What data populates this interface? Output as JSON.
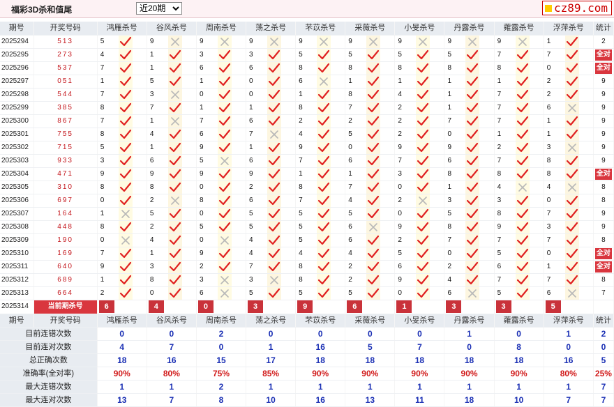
{
  "header": {
    "title": "福彩3D杀和值尾",
    "period_select": "近20期",
    "logo_text": "cz89.com"
  },
  "columns": {
    "issue": "期号",
    "numbers": "开奖号码",
    "groups": [
      "鸿雁杀号",
      "谷风杀号",
      "周南杀号",
      "荡之杀号",
      "芣苡杀号",
      "采薇杀号",
      "小旻杀号",
      "丹露杀号",
      "蕹露杀号",
      "浮萍杀号"
    ],
    "stat": "统计"
  },
  "rows": [
    {
      "issue": "2025294",
      "num": "513",
      "kill": [
        "5",
        "9",
        "9",
        "9",
        "9",
        "9",
        "9",
        "9",
        "9",
        "1"
      ],
      "ok": [
        1,
        0,
        0,
        0,
        0,
        0,
        0,
        0,
        0,
        1
      ],
      "stat": "2"
    },
    {
      "issue": "2025295",
      "num": "273",
      "kill": [
        "4",
        "1",
        "3",
        "3",
        "5",
        "5",
        "5",
        "5",
        "7",
        "7"
      ],
      "ok": [
        1,
        1,
        1,
        1,
        1,
        1,
        1,
        1,
        1,
        1
      ],
      "stat": "全对"
    },
    {
      "issue": "2025296",
      "num": "537",
      "kill": [
        "7",
        "1",
        "6",
        "6",
        "8",
        "8",
        "8",
        "8",
        "8",
        "0"
      ],
      "ok": [
        1,
        1,
        1,
        1,
        1,
        1,
        1,
        1,
        1,
        1
      ],
      "stat": "全对"
    },
    {
      "issue": "2025297",
      "num": "051",
      "kill": [
        "1",
        "5",
        "1",
        "0",
        "6",
        "1",
        "1",
        "1",
        "1",
        "2"
      ],
      "ok": [
        1,
        1,
        1,
        1,
        0,
        1,
        1,
        1,
        1,
        1
      ],
      "stat": "9"
    },
    {
      "issue": "2025298",
      "num": "544",
      "kill": [
        "7",
        "3",
        "0",
        "0",
        "1",
        "8",
        "4",
        "1",
        "7",
        "2"
      ],
      "ok": [
        1,
        0,
        1,
        1,
        1,
        1,
        1,
        1,
        1,
        1
      ],
      "stat": "9"
    },
    {
      "issue": "2025299",
      "num": "385",
      "kill": [
        "8",
        "7",
        "1",
        "1",
        "8",
        "7",
        "2",
        "1",
        "7",
        "6"
      ],
      "ok": [
        1,
        1,
        1,
        1,
        1,
        1,
        1,
        1,
        1,
        0
      ],
      "stat": "9"
    },
    {
      "issue": "2025300",
      "num": "867",
      "kill": [
        "7",
        "1",
        "7",
        "6",
        "2",
        "2",
        "2",
        "7",
        "7",
        "1"
      ],
      "ok": [
        1,
        0,
        1,
        1,
        1,
        1,
        1,
        1,
        1,
        1
      ],
      "stat": "9"
    },
    {
      "issue": "2025301",
      "num": "755",
      "kill": [
        "8",
        "4",
        "6",
        "7",
        "4",
        "5",
        "2",
        "0",
        "1",
        "1"
      ],
      "ok": [
        1,
        1,
        1,
        0,
        1,
        1,
        1,
        1,
        1,
        1
      ],
      "stat": "9"
    },
    {
      "issue": "2025302",
      "num": "715",
      "kill": [
        "5",
        "1",
        "9",
        "1",
        "9",
        "0",
        "9",
        "9",
        "2",
        "3"
      ],
      "ok": [
        1,
        1,
        1,
        1,
        1,
        1,
        1,
        1,
        1,
        0
      ],
      "stat": "9"
    },
    {
      "issue": "2025303",
      "num": "933",
      "kill": [
        "3",
        "6",
        "5",
        "6",
        "7",
        "6",
        "7",
        "6",
        "7",
        "8"
      ],
      "ok": [
        1,
        1,
        0,
        1,
        1,
        1,
        1,
        1,
        1,
        1
      ],
      "stat": "9"
    },
    {
      "issue": "2025304",
      "num": "471",
      "kill": [
        "9",
        "9",
        "9",
        "9",
        "1",
        "1",
        "3",
        "8",
        "8",
        "8"
      ],
      "ok": [
        1,
        1,
        1,
        1,
        1,
        1,
        1,
        1,
        1,
        1
      ],
      "stat": "全对"
    },
    {
      "issue": "2025305",
      "num": "310",
      "kill": [
        "8",
        "8",
        "0",
        "2",
        "8",
        "7",
        "0",
        "1",
        "4",
        "4"
      ],
      "ok": [
        1,
        1,
        1,
        1,
        1,
        1,
        1,
        1,
        0,
        0
      ],
      "stat": "8"
    },
    {
      "issue": "2025306",
      "num": "697",
      "kill": [
        "0",
        "2",
        "8",
        "6",
        "7",
        "4",
        "2",
        "3",
        "3",
        "0"
      ],
      "ok": [
        1,
        0,
        1,
        1,
        1,
        1,
        0,
        1,
        1,
        1
      ],
      "stat": "8"
    },
    {
      "issue": "2025307",
      "num": "164",
      "kill": [
        "1",
        "5",
        "0",
        "5",
        "5",
        "5",
        "0",
        "5",
        "8",
        "7"
      ],
      "ok": [
        0,
        1,
        1,
        1,
        1,
        1,
        1,
        1,
        1,
        1
      ],
      "stat": "9"
    },
    {
      "issue": "2025308",
      "num": "448",
      "kill": [
        "8",
        "2",
        "5",
        "5",
        "5",
        "6",
        "9",
        "8",
        "9",
        "3"
      ],
      "ok": [
        1,
        1,
        1,
        1,
        1,
        0,
        1,
        1,
        1,
        1
      ],
      "stat": "9"
    },
    {
      "issue": "2025309",
      "num": "190",
      "kill": [
        "0",
        "4",
        "0",
        "4",
        "5",
        "6",
        "2",
        "7",
        "7",
        "7"
      ],
      "ok": [
        0,
        1,
        0,
        1,
        1,
        1,
        1,
        1,
        1,
        1
      ],
      "stat": "8"
    },
    {
      "issue": "2025310",
      "num": "169",
      "kill": [
        "7",
        "1",
        "9",
        "4",
        "4",
        "4",
        "5",
        "0",
        "5",
        "0"
      ],
      "ok": [
        1,
        1,
        1,
        1,
        1,
        1,
        1,
        1,
        1,
        1
      ],
      "stat": "全对"
    },
    {
      "issue": "2025311",
      "num": "640",
      "kill": [
        "9",
        "3",
        "2",
        "7",
        "8",
        "2",
        "6",
        "2",
        "6",
        "1"
      ],
      "ok": [
        1,
        1,
        1,
        1,
        1,
        1,
        1,
        1,
        1,
        1
      ],
      "stat": "全对"
    },
    {
      "issue": "2025312",
      "num": "689",
      "kill": [
        "1",
        "8",
        "3",
        "3",
        "8",
        "2",
        "9",
        "4",
        "7",
        "7"
      ],
      "ok": [
        1,
        1,
        0,
        0,
        1,
        1,
        1,
        1,
        1,
        1
      ],
      "stat": "8"
    },
    {
      "issue": "2025313",
      "num": "664",
      "kill": [
        "2",
        "0",
        "6",
        "5",
        "5",
        "5",
        "0",
        "6",
        "5",
        "6"
      ],
      "ok": [
        1,
        1,
        0,
        1,
        1,
        1,
        1,
        0,
        1,
        0
      ],
      "stat": "7"
    }
  ],
  "current": {
    "issue": "2025314",
    "label": "当前期杀号",
    "values": [
      "6",
      "4",
      "0",
      "3",
      "9",
      "6",
      "1",
      "3",
      "3",
      "5"
    ]
  },
  "summary": [
    {
      "label": "目前连错次数",
      "values": [
        "0",
        "0",
        "2",
        "0",
        "0",
        "0",
        "0",
        "1",
        "0",
        "1"
      ],
      "stat": "2"
    },
    {
      "label": "目前连对次数",
      "values": [
        "4",
        "7",
        "0",
        "1",
        "16",
        "5",
        "7",
        "0",
        "8",
        "0"
      ],
      "stat": "0"
    },
    {
      "label": "总正确次数",
      "values": [
        "18",
        "16",
        "15",
        "17",
        "18",
        "18",
        "18",
        "18",
        "18",
        "16"
      ],
      "stat": "5"
    },
    {
      "label": "准确率(全对率)",
      "values": [
        "90%",
        "80%",
        "75%",
        "85%",
        "90%",
        "90%",
        "90%",
        "90%",
        "90%",
        "80%"
      ],
      "stat": "25%",
      "red": true
    },
    {
      "label": "最大连错次数",
      "values": [
        "1",
        "1",
        "2",
        "1",
        "1",
        "1",
        "1",
        "1",
        "1",
        "1"
      ],
      "stat": "7"
    },
    {
      "label": "最大连对次数",
      "values": [
        "13",
        "7",
        "8",
        "10",
        "16",
        "13",
        "11",
        "18",
        "10",
        "7"
      ],
      "stat": "7"
    }
  ],
  "colors": {
    "check": "#e02020",
    "cross": "#b8b8b8",
    "header_bg": "#e8ecf1",
    "accent_red": "#d9363e",
    "summary_blue": "#1a2fb4"
  }
}
